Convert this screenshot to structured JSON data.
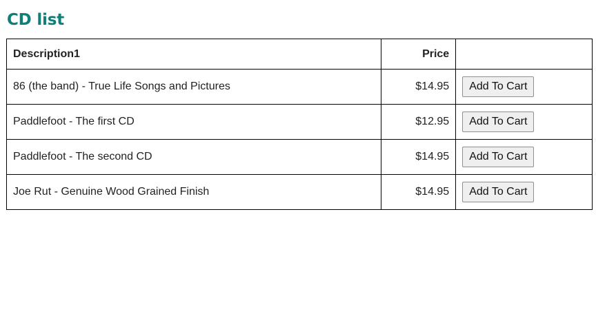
{
  "page": {
    "title": "CD list"
  },
  "table": {
    "headers": {
      "description": "Description1",
      "price": "Price",
      "action": ""
    },
    "rows": [
      {
        "description": "86 (the band) - True Life Songs and Pictures",
        "price": "$14.95",
        "button_label": "Add To Cart"
      },
      {
        "description": "Paddlefoot - The first CD",
        "price": "$12.95",
        "button_label": "Add To Cart"
      },
      {
        "description": "Paddlefoot - The second CD",
        "price": "$14.95",
        "button_label": "Add To Cart"
      },
      {
        "description": "Joe Rut - Genuine Wood Grained Finish",
        "price": "$14.95",
        "button_label": "Add To Cart"
      }
    ]
  },
  "colors": {
    "title": "#0f7f78",
    "border": "#000000",
    "button_bg": "#efefef"
  }
}
